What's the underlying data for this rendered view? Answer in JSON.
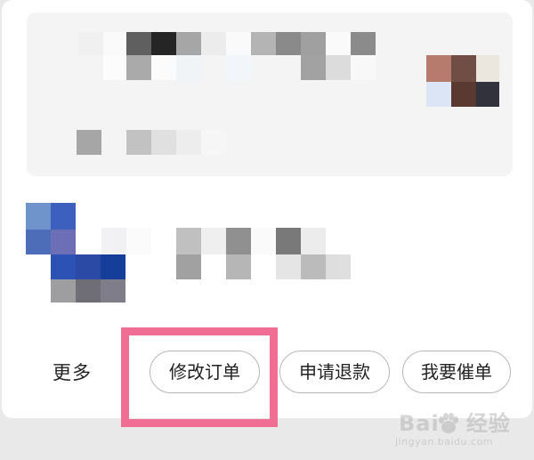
{
  "order_actions": {
    "more_label": "更多",
    "modify_button": "修改订单",
    "refund_button": "申请退款",
    "urge_button": "我要催单"
  },
  "watermark": {
    "brand": "Bai",
    "brand_suffix": "经验",
    "url": "jingyan.baidu.com"
  },
  "colors": {
    "highlight": "#f06d94",
    "button_border": "#b7b7b7",
    "card_bg": "#ffffff",
    "product_bg": "#f4f4f4"
  }
}
